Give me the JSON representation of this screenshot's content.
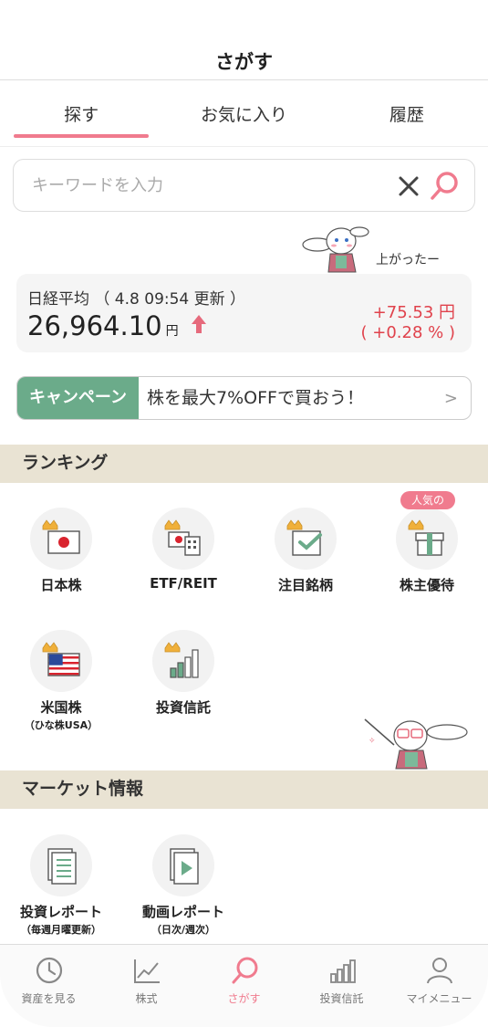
{
  "header": {
    "title": "さがす"
  },
  "tabs": [
    {
      "label": "探す",
      "active": true
    },
    {
      "label": "お気に入り",
      "active": false
    },
    {
      "label": "履歴",
      "active": false
    }
  ],
  "search": {
    "placeholder": "キーワードを入力"
  },
  "mascot_bubble": "上がったー",
  "nikkei": {
    "label": "日経平均 （ 4.8 09:54 更新 ）",
    "value": "26,964.10",
    "unit": "円",
    "change": "+75.53 円",
    "pct": "( +0.28 % )",
    "direction": "up",
    "up_color": "#e0424c"
  },
  "campaign": {
    "tag": "キャンペーン",
    "text": "株を最大7%OFFで買おう！",
    "chevron": ">"
  },
  "ranking": {
    "title": "ランキング",
    "badge_popular": "人気の",
    "items": [
      {
        "label": "日本株",
        "icon": "japan-flag-icon"
      },
      {
        "label": "ETF/REIT",
        "icon": "etf-reit-icon"
      },
      {
        "label": "注目銘柄",
        "icon": "watchlist-check-icon"
      },
      {
        "label": "株主優待",
        "icon": "gift-box-icon"
      },
      {
        "label": "米国株",
        "sublabel": "（ひな株USA）",
        "icon": "us-flag-icon"
      },
      {
        "label": "投資信託",
        "icon": "bar-chart-icon"
      }
    ]
  },
  "market": {
    "title": "マーケット情報",
    "items": [
      {
        "label": "投資レポート",
        "sublabel": "（毎週月曜更新）",
        "icon": "report-document-icon"
      },
      {
        "label": "動画レポート",
        "sublabel": "（日次/週次）",
        "icon": "video-report-icon"
      }
    ]
  },
  "bottom_nav": [
    {
      "label": "資産を見る",
      "icon": "pie-clock-icon",
      "active": false
    },
    {
      "label": "株式",
      "icon": "line-chart-icon",
      "active": false
    },
    {
      "label": "さがす",
      "icon": "search-icon",
      "active": true
    },
    {
      "label": "投資信託",
      "icon": "bar-chart-icon",
      "active": false
    },
    {
      "label": "マイメニュー",
      "icon": "user-icon",
      "active": false
    }
  ],
  "colors": {
    "accent": "#f07b8e",
    "campaign_green": "#6bab8a",
    "section_bg": "#e9e3d3",
    "up_red": "#e0424c"
  }
}
